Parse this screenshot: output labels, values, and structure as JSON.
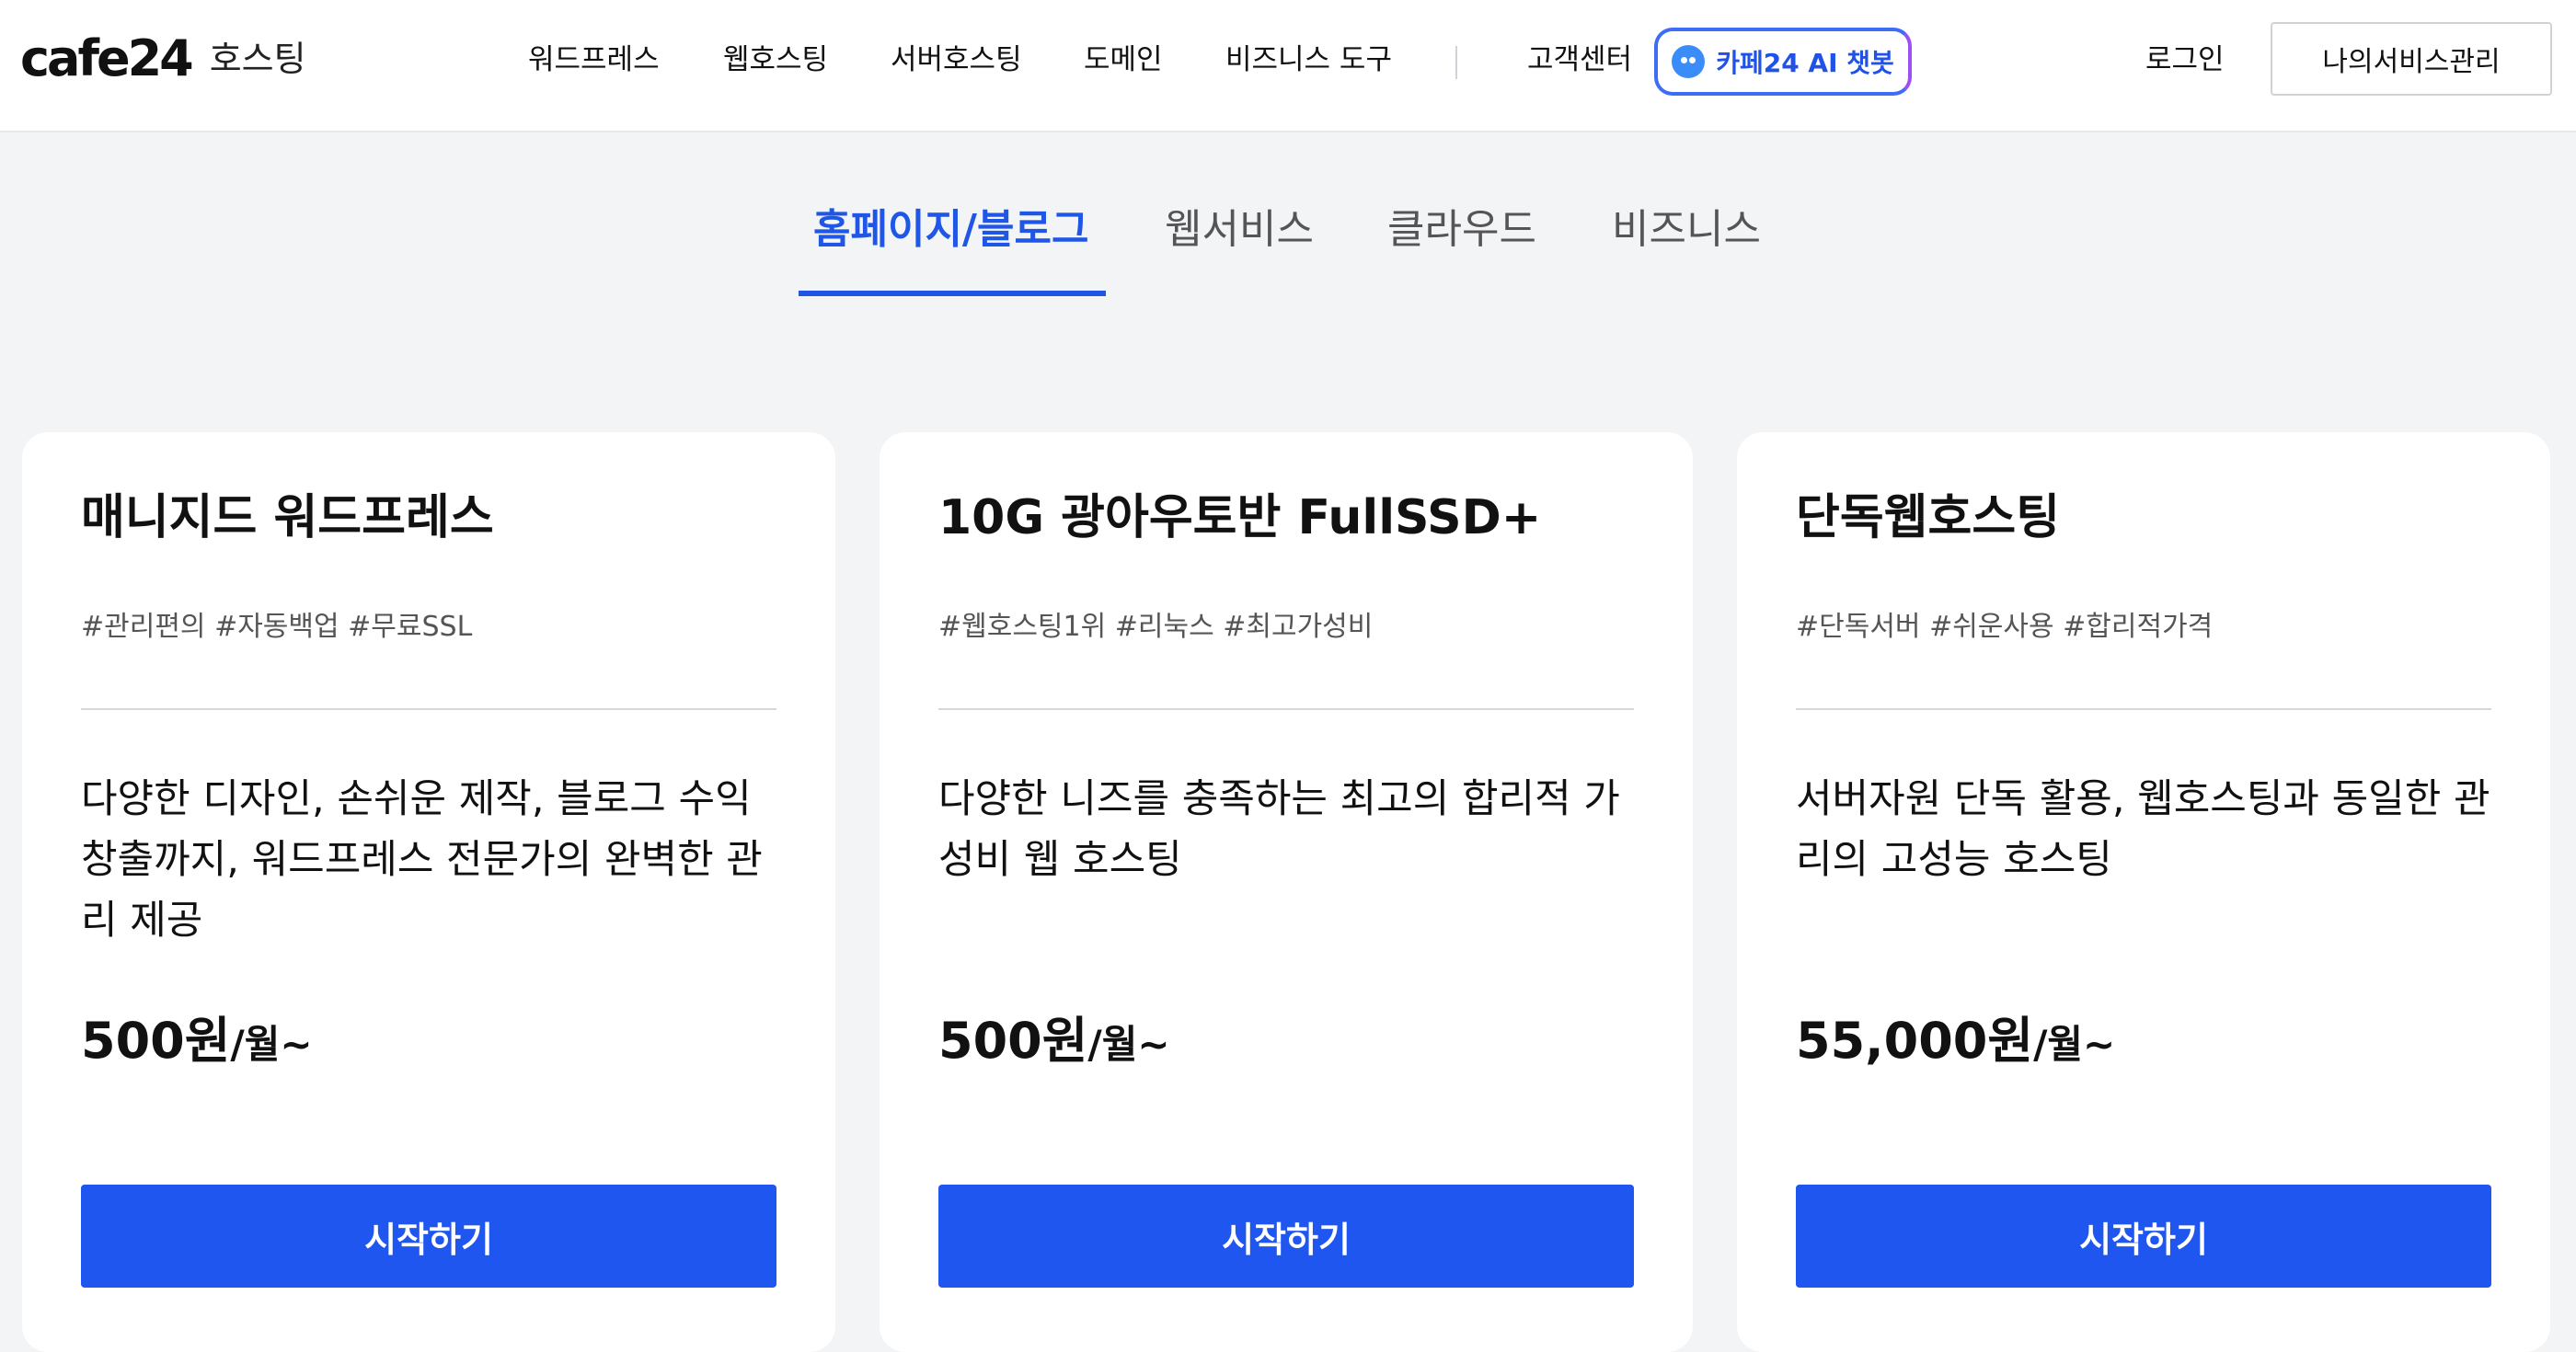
{
  "header": {
    "logo_text": "cafe24",
    "logo_sub": "호스팅",
    "nav": [
      "워드프레스",
      "웹호스팅",
      "서버호스팅",
      "도메인",
      "비즈니스 도구"
    ],
    "support": "고객센터",
    "ai_chatbot": "카페24 AI 챗봇",
    "login": "로그인",
    "my_service": "나의서비스관리"
  },
  "tabs": [
    "홈페이지/블로그",
    "웹서비스",
    "클라우드",
    "비즈니스"
  ],
  "active_tab": "홈페이지/블로그",
  "cards": [
    {
      "title": "매니지드 워드프레스",
      "tags": "#관리편의 #자동백업 #무료SSL",
      "description": "다양한 디자인, 손쉬운 제작, 블로그 수익 창출까지, 워드프레스 전문가의 완벽한 관리 제공",
      "price": "500원",
      "unit": "/월~",
      "button": "시작하기"
    },
    {
      "title": "10G 광아우토반 FullSSD+",
      "tags": "#웹호스팅1위 #리눅스 #최고가성비",
      "description": "다양한 니즈를 충족하는 최고의 합리적 가성비 웹 호스팅",
      "price": "500원",
      "unit": "/월~",
      "button": "시작하기"
    },
    {
      "title": "단독웹호스팅",
      "tags": "#단독서버 #쉬운사용 #합리적가격",
      "description": "서버자원 단독 활용, 웹호스팅과 동일한 관리의 고성능 호스팅",
      "price": "55,000원",
      "unit": "/월~",
      "button": "시작하기"
    }
  ],
  "colors": {
    "accent": "#1f56e6",
    "button": "#1f56f0",
    "background": "#f3f4f6"
  }
}
